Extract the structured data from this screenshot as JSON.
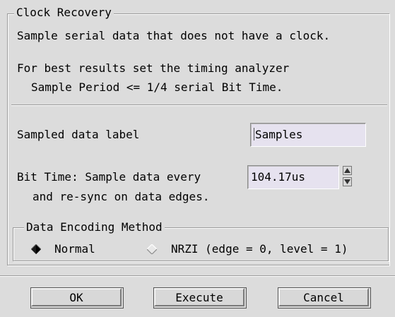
{
  "dialog": {
    "group_title": "Clock Recovery",
    "description": "Sample serial data that does not have a clock.",
    "hint_line1": "For best results set the timing analyzer",
    "hint_line2": "Sample Period <= 1/4 serial Bit Time."
  },
  "sampled_label": {
    "label": "Sampled data label",
    "value": "Samples"
  },
  "bit_time": {
    "label_line1": "Bit Time: Sample data every",
    "label_line2": "and re-sync on data edges.",
    "value": "104.17us"
  },
  "encoding": {
    "title": "Data Encoding Method",
    "options": [
      {
        "label": "Normal",
        "selected": true
      },
      {
        "label": "NRZI (edge = 0, level = 1)",
        "selected": false
      }
    ]
  },
  "buttons": {
    "ok": "OK",
    "execute": "Execute",
    "cancel": "Cancel"
  },
  "colors": {
    "background": "#dcdcdc",
    "field_background": "#e6e2ef"
  }
}
